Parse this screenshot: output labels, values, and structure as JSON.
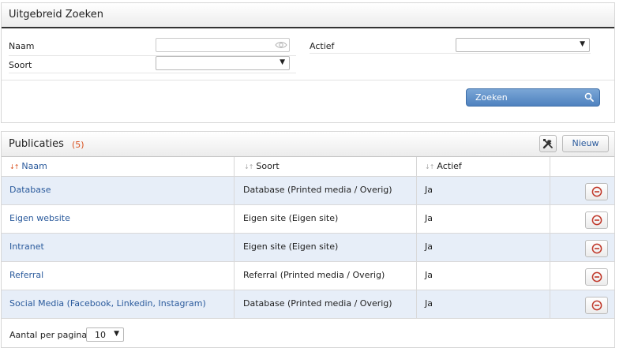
{
  "search": {
    "title": "Uitgebreid Zoeken",
    "naam_label": "Naam",
    "naam_value": "",
    "soort_label": "Soort",
    "soort_value": "",
    "actief_label": "Actief",
    "actief_value": "",
    "button_label": "Zoeken"
  },
  "publications": {
    "title": "Publicaties",
    "count": "(5)",
    "new_label": "Nieuw",
    "columns": {
      "name": "Naam",
      "type": "Soort",
      "active": "Actief"
    },
    "rows": [
      {
        "name": "Database",
        "type": "Database (Printed media / Overig)",
        "active": "Ja"
      },
      {
        "name": "Eigen website",
        "type": "Eigen site (Eigen site)",
        "active": "Ja"
      },
      {
        "name": "Intranet",
        "type": "Eigen site (Eigen site)",
        "active": "Ja"
      },
      {
        "name": "Referral",
        "type": "Referral (Printed media / Overig)",
        "active": "Ja"
      },
      {
        "name": "Social Media (Facebook, Linkedin, Instagram)",
        "type": "Database (Printed media / Overig)",
        "active": "Ja"
      }
    ],
    "per_page_label": "Aantal per pagina:",
    "per_page_value": "10"
  },
  "colors": {
    "accent": "#4f82bf",
    "link": "#2a5a9c",
    "count": "#d9501e",
    "row_alt": "#e7eef8",
    "delete": "#c0392b"
  },
  "icons": {
    "naam_reveal": "eye-icon",
    "search": "search-icon",
    "tools": "wrench-screwdriver-icon",
    "delete": "minus-circle-icon",
    "dropdown": "caret-down-icon",
    "sort": "sort-arrows-icon"
  }
}
